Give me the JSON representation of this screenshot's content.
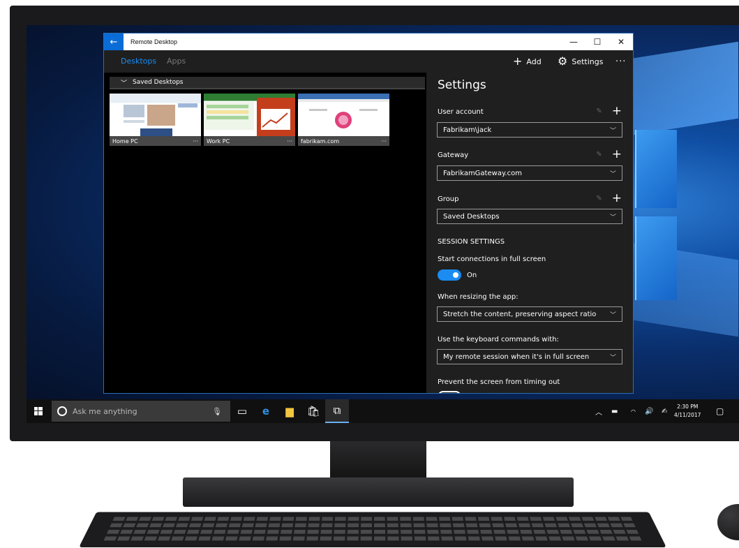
{
  "window": {
    "title": "Remote Desktop",
    "back_icon": "←",
    "minimize_icon": "—",
    "maximize_icon": "☐",
    "close_icon": "✕"
  },
  "commandbar": {
    "tabs": [
      {
        "label": "Desktops",
        "active": true
      },
      {
        "label": "Apps",
        "active": false
      }
    ],
    "add_label": "Add",
    "settings_label": "Settings",
    "more_icon": "···"
  },
  "desktops": {
    "group_title": "Saved Desktops",
    "items": [
      {
        "label": "Home PC"
      },
      {
        "label": "Work PC"
      },
      {
        "label": "fabrikam.com"
      }
    ],
    "more_icon": "···"
  },
  "settings": {
    "title": "Settings",
    "user_account": {
      "label": "User account",
      "value": "Fabrikam\\jack"
    },
    "gateway": {
      "label": "Gateway",
      "value": "FabrikamGateway.com"
    },
    "group": {
      "label": "Group",
      "value": "Saved Desktops"
    },
    "session_header": "SESSION SETTINGS",
    "full_screen": {
      "label": "Start connections in full screen",
      "state": "On"
    },
    "resize": {
      "label": "When resizing the app:",
      "value": "Stretch the content, preserving aspect ratio"
    },
    "keyboard": {
      "label": "Use the keyboard commands with:",
      "value": "My remote session when it's in full screen"
    },
    "timeout": {
      "label": "Prevent the screen from timing out",
      "state": "Off"
    }
  },
  "taskbar": {
    "search_placeholder": "Ask me anything",
    "clock_time": "2:30 PM",
    "clock_date": "4/11/2017"
  },
  "colors": {
    "accent": "#1b8cf2",
    "titlebar_back": "#0a6cd6",
    "pane_bg": "#1f1f1f"
  }
}
